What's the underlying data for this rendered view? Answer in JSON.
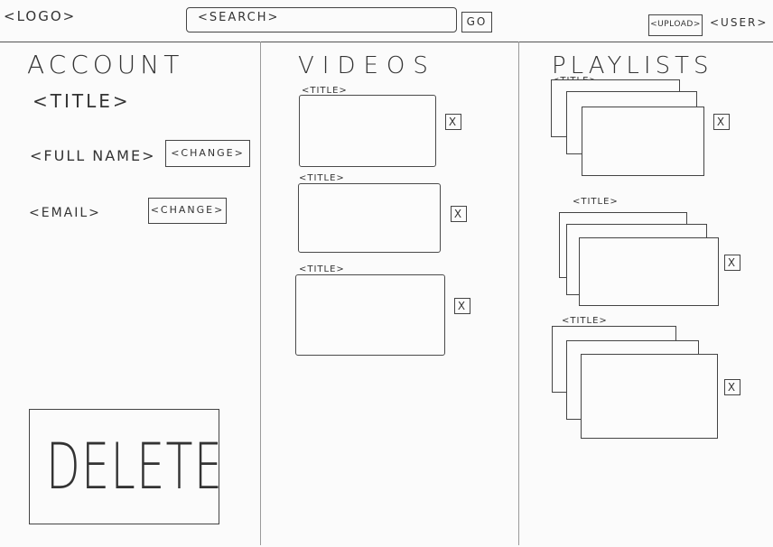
{
  "header": {
    "logo": "<LOGO>",
    "search_placeholder": "<SEARCH>",
    "go_label": "GO",
    "upload_label": "<UPLOAD>",
    "user_label": "<USER>"
  },
  "account": {
    "heading": "ACCOUNT",
    "title": "<TITLE>",
    "fullname_label": "<FULL NAME>",
    "change_name_label": "<CHANGE>",
    "email_label": "<EMAIL>",
    "change_email_label": "<CHANGE>",
    "delete_label": "DELETE"
  },
  "videos": {
    "heading": "VIDEOS",
    "items": [
      {
        "title": "<TITLE>",
        "remove": "X"
      },
      {
        "title": "<TITLE>",
        "remove": "X"
      },
      {
        "title": "<TITLE>",
        "remove": "X"
      }
    ]
  },
  "playlists": {
    "heading": "PLAYLISTS",
    "items": [
      {
        "title": "<TITLE>",
        "remove": "X"
      },
      {
        "title": "<TITLE>",
        "remove": "X"
      },
      {
        "title": "<TITLE>",
        "remove": "X"
      }
    ]
  }
}
